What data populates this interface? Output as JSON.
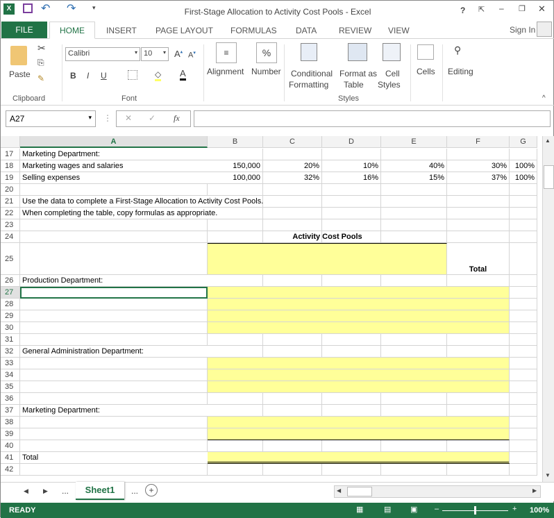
{
  "window": {
    "title": "First-Stage Allocation to Activity Cost Pools - Excel",
    "help": "?",
    "sign_in": "Sign In"
  },
  "tabs": [
    "FILE",
    "HOME",
    "INSERT",
    "PAGE LAYOUT",
    "FORMULAS",
    "DATA",
    "REVIEW",
    "VIEW"
  ],
  "ribbon": {
    "paste": "Paste",
    "font_name": "Calibri",
    "font_size": "10",
    "bold": "B",
    "italic": "I",
    "underline": "U",
    "alignment": "Alignment",
    "number": "Number",
    "percent": "%",
    "conditional": "Conditional",
    "formatting": "Formatting",
    "format_as": "Format as",
    "table": "Table",
    "cell": "Cell",
    "styles_btn": "Styles",
    "cells": "Cells",
    "editing": "Editing",
    "groups": {
      "clipboard": "Clipboard",
      "font": "Font",
      "styles": "Styles"
    }
  },
  "formula_bar": {
    "name_box": "A27",
    "fx": "fx",
    "value": ""
  },
  "columns": [
    "A",
    "B",
    "C",
    "D",
    "E",
    "F",
    "G"
  ],
  "rows": [
    {
      "n": "17",
      "A": "Marketing Department:"
    },
    {
      "n": "18",
      "A": " Marketing wages and salaries",
      "B": "150,000",
      "C": "20%",
      "D": "10%",
      "E": "40%",
      "F": "30%",
      "G": "100%"
    },
    {
      "n": "19",
      "A": " Selling expenses",
      "B": "100,000",
      "C": "32%",
      "D": "16%",
      "E": "15%",
      "F": "37%",
      "G": "100%"
    },
    {
      "n": "20"
    },
    {
      "n": "21",
      "A": "Use the data to complete a First-Stage Allocation to Activity Cost Pools."
    },
    {
      "n": "22",
      "A": "When completing the table, copy formulas as appropriate."
    },
    {
      "n": "23"
    },
    {
      "n": "24",
      "header": "Activity Cost Pools"
    },
    {
      "n": "25",
      "F": "Total"
    },
    {
      "n": "26",
      "A": "Production Department:"
    },
    {
      "n": "27"
    },
    {
      "n": "28"
    },
    {
      "n": "29"
    },
    {
      "n": "30"
    },
    {
      "n": "31"
    },
    {
      "n": "32",
      "A": "General Administration Department:"
    },
    {
      "n": "33"
    },
    {
      "n": "34"
    },
    {
      "n": "35"
    },
    {
      "n": "36"
    },
    {
      "n": "37",
      "A": "Marketing Department:"
    },
    {
      "n": "38"
    },
    {
      "n": "39"
    },
    {
      "n": "40"
    },
    {
      "n": "41",
      "A": "Total"
    },
    {
      "n": "42"
    }
  ],
  "sheet_tabs": {
    "active": "Sheet1",
    "more": "..."
  },
  "status": {
    "ready": "READY",
    "zoom": "100%"
  },
  "colors": {
    "accent": "#217346",
    "fill": "#ffff99"
  }
}
